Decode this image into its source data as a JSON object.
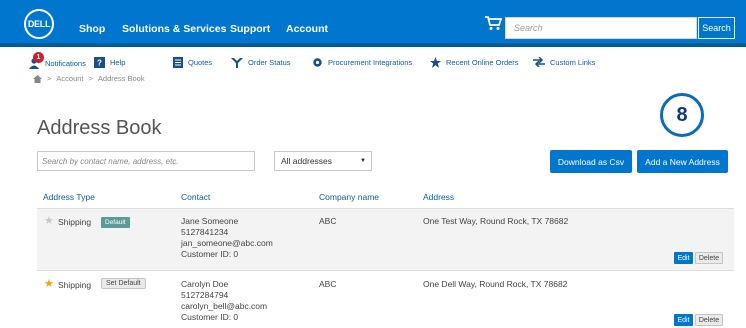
{
  "header": {
    "logo_text": "DELL",
    "nav": [
      "Shop",
      "Solutions & Services",
      "Support",
      "Account"
    ],
    "search_placeholder": "Search",
    "search_button": "Search"
  },
  "shortcuts": {
    "notification_count": "1",
    "items": [
      "Notifications",
      "Help",
      "Quotes",
      "Order Status",
      "Procurement Integrations",
      "Recent Online Orders",
      "Custom Links"
    ]
  },
  "breadcrumb": [
    "Account",
    "Address Book"
  ],
  "step_number": "8",
  "page_title": "Address Book",
  "filter": {
    "placeholder": "Search by contact name, address, etc.",
    "select_value": "All addresses"
  },
  "buttons": {
    "download": "Download as Csv",
    "add": "Add a New Address"
  },
  "table": {
    "headers": [
      "Address Type",
      "Contact",
      "Company name",
      "Address"
    ],
    "rows": [
      {
        "type": "Shipping",
        "tag": "Default",
        "contact": [
          "Jane Someone",
          "5127841234",
          "jan_someone@abc.com",
          "Customer ID: 0"
        ],
        "company": "ABC",
        "address": "One Test Way, Round Rock, TX 78682",
        "edit": "Edit",
        "delete": "Delete"
      },
      {
        "type": "Shipping",
        "tag": "Set Default",
        "contact": [
          "Carolyn Doe",
          "5127284794",
          "carolyn_bell@abc.com",
          "Customer ID: 0"
        ],
        "company": "ABC",
        "address": "One Dell Way, Round Rock, TX 78682",
        "edit": "Edit",
        "delete": "Delete"
      }
    ]
  },
  "colors": {
    "primary": "#0076ce",
    "star_gray": "#c8c8c8",
    "star_gold": "#f2a100",
    "default_tag": "#5b9a97"
  }
}
